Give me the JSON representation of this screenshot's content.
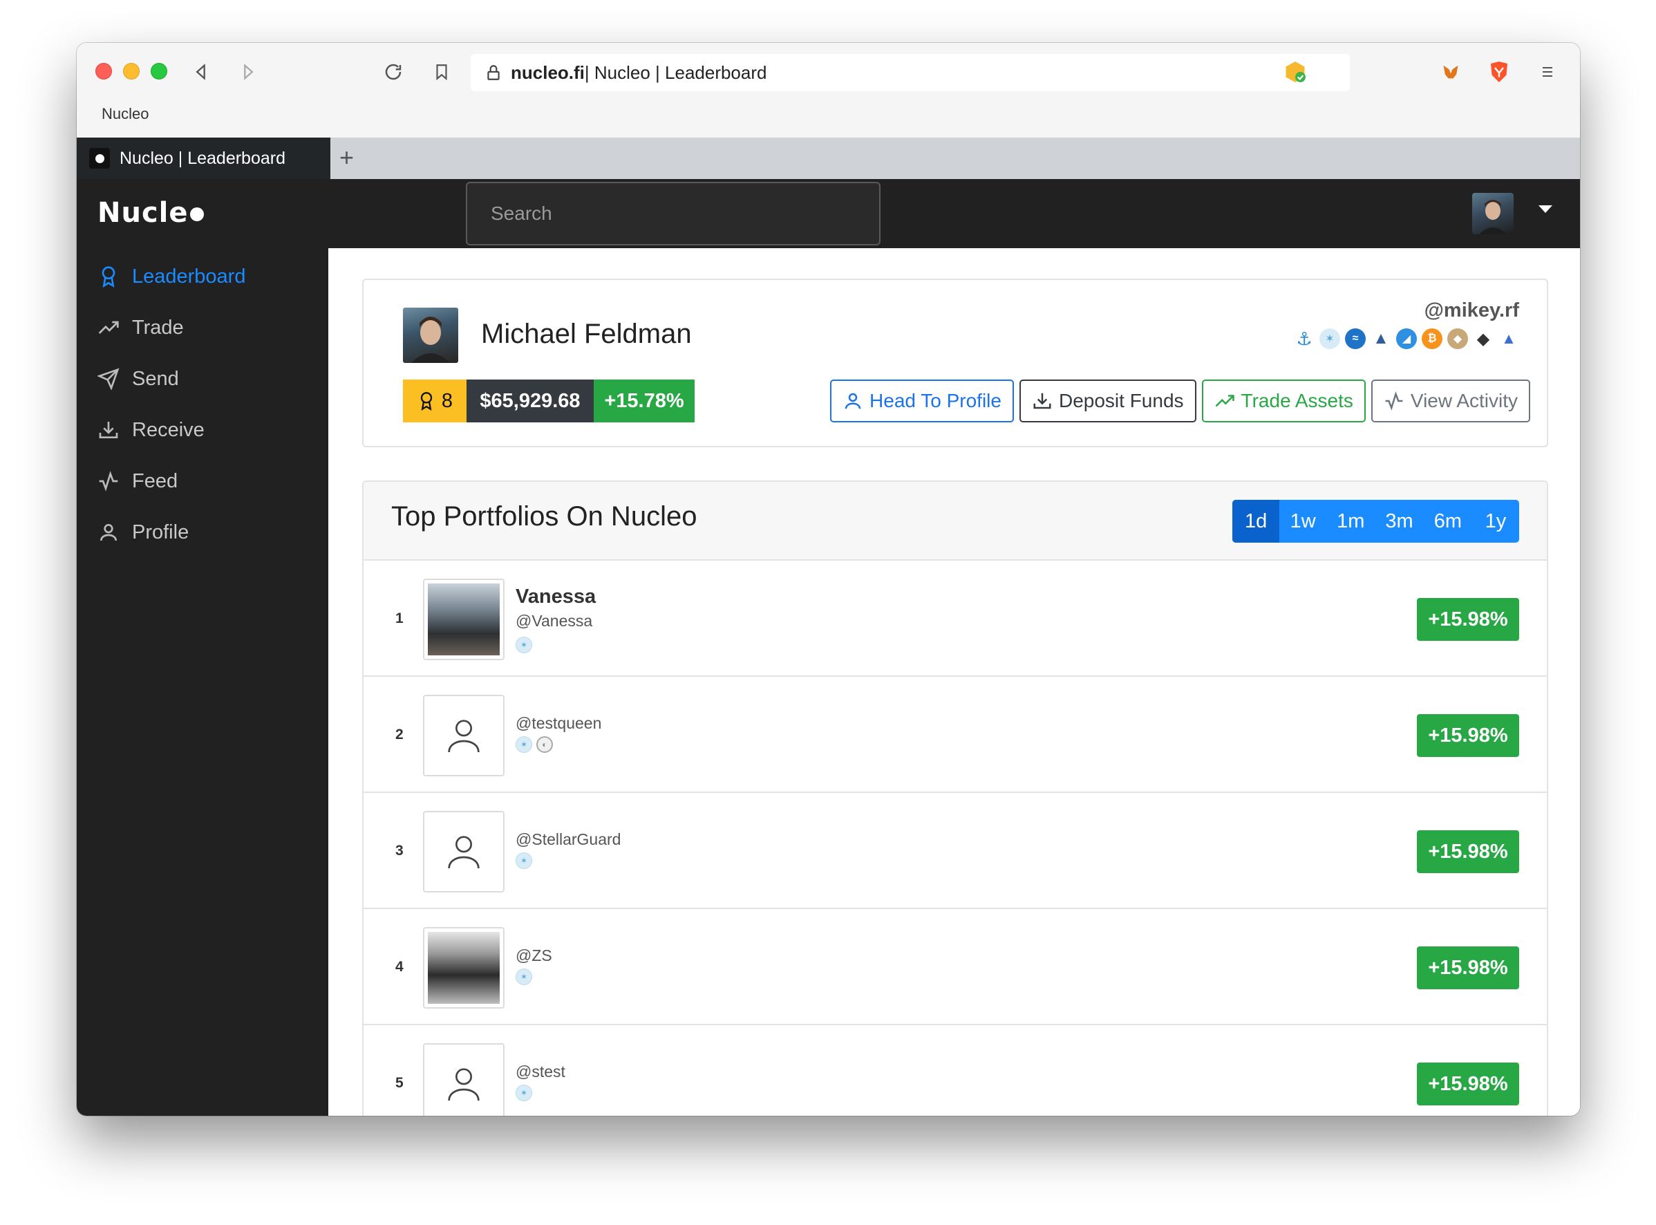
{
  "browser": {
    "url_host": "nucleo.fi",
    "url_rest": " | Nucleo | Leaderboard",
    "bookmark": "Nucleo",
    "tab_title": "Nucleo | Leaderboard",
    "new_tab": "+"
  },
  "navbar": {
    "brand": "Nucle",
    "search_placeholder": "Search"
  },
  "sidebar": {
    "items": [
      {
        "label": "Leaderboard",
        "icon": "award-icon",
        "active": true
      },
      {
        "label": "Trade",
        "icon": "trending-up-icon"
      },
      {
        "label": "Send",
        "icon": "send-icon"
      },
      {
        "label": "Receive",
        "icon": "download-icon"
      },
      {
        "label": "Feed",
        "icon": "activity-icon"
      },
      {
        "label": "Profile",
        "icon": "user-icon"
      }
    ]
  },
  "profile": {
    "name": "Michael Feldman",
    "handle": "@mikey.rf",
    "rank": "8",
    "value": "$65,929.68",
    "change": "+15.78%",
    "coins": [
      "anchor",
      "stellar",
      "stream",
      "flame",
      "nexus",
      "send",
      "bitcoin",
      "lion",
      "ethereum",
      "arrow"
    ],
    "actions": {
      "head_to_profile": "Head To Profile",
      "deposit_funds": "Deposit Funds",
      "trade_assets": "Trade Assets",
      "view_activity": "View Activity"
    }
  },
  "leaderboard": {
    "title": "Top Portfolios On Nucleo",
    "ranges": [
      "1d",
      "1w",
      "1m",
      "3m",
      "6m",
      "1y"
    ],
    "active_range": "1d",
    "rows": [
      {
        "rank": "1",
        "name": "Vanessa",
        "handle": "@Vanessa",
        "change": "+15.98%"
      },
      {
        "rank": "2",
        "name": "",
        "handle": "@testqueen",
        "change": "+15.98%"
      },
      {
        "rank": "3",
        "name": "",
        "handle": "@StellarGuard",
        "change": "+15.98%"
      },
      {
        "rank": "4",
        "name": "",
        "handle": "@ZS",
        "change": "+15.98%"
      },
      {
        "rank": "5",
        "name": "",
        "handle": "@stest",
        "change": "+15.98%"
      }
    ]
  }
}
